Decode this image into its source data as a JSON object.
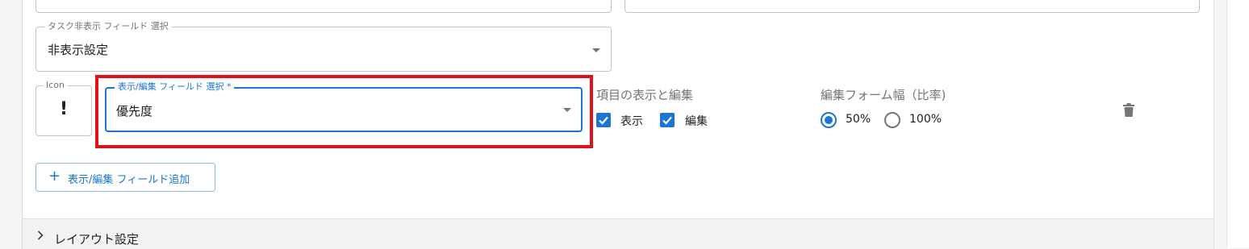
{
  "hide_field": {
    "legend": "タスク非表示 フィールド 選択",
    "value": "非表示設定"
  },
  "icon_field": {
    "legend": "Icon",
    "value": "!"
  },
  "display_field": {
    "legend": "表示/編集 フィールド 選択 *",
    "value": "優先度"
  },
  "visibility": {
    "title": "項目の表示と編集",
    "display_label": "表示",
    "display_checked": true,
    "edit_label": "編集",
    "edit_checked": true
  },
  "form_width": {
    "title": "編集フォーム幅（比率)",
    "options": [
      {
        "label": "50%",
        "selected": true
      },
      {
        "label": "100%",
        "selected": false
      }
    ]
  },
  "add_button": {
    "plus": "+",
    "label": "表示/編集 フィールド追加"
  },
  "layout_section": {
    "label": "レイアウト設定"
  },
  "colors": {
    "accent": "#1976d2",
    "highlight": "#e0111a"
  }
}
